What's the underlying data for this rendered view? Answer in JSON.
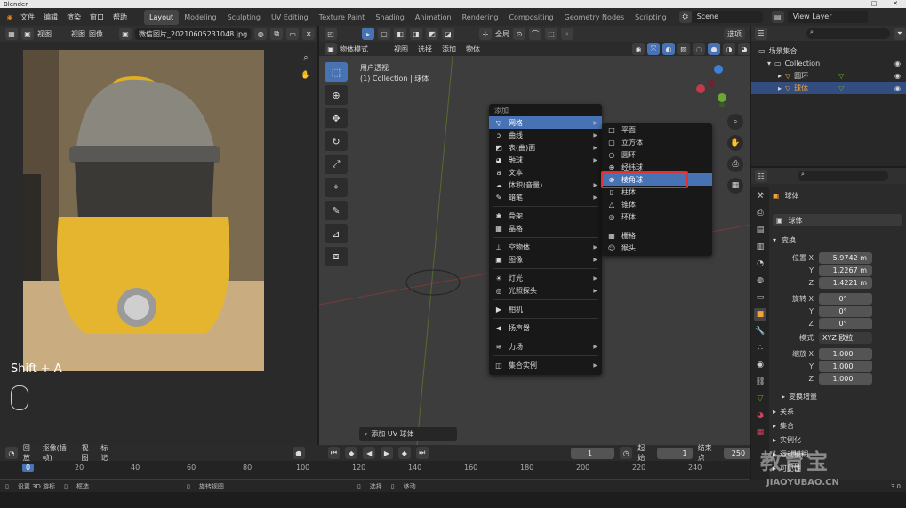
{
  "title": "Blender",
  "menu": [
    "文件",
    "编辑",
    "渲染",
    "窗口",
    "帮助"
  ],
  "workspaces": [
    "Layout",
    "Modeling",
    "Sculpting",
    "UV Editing",
    "Texture Paint",
    "Shading",
    "Animation",
    "Rendering",
    "Compositing",
    "Geometry Nodes",
    "Scripting"
  ],
  "scene": "Scene",
  "view_layer": "View Layer",
  "image_editor": {
    "menus": [
      "视图",
      "视图",
      "图像"
    ],
    "filename": "微信图片_20210605231048.jpg",
    "overlay_text": "Shift + A"
  },
  "viewport": {
    "mode": "物体模式",
    "menus": [
      "视图",
      "选择",
      "添加",
      "物体"
    ],
    "transform": "全局",
    "options": "选项",
    "view_name": "用户透视",
    "collection": "(1) Collection | 球体"
  },
  "add_menu": {
    "title": "添加",
    "items": [
      {
        "label": "网格",
        "glyph": "▽",
        "sub": true
      },
      {
        "label": "曲线",
        "glyph": "ↄ",
        "sub": true
      },
      {
        "label": "表(曲)面",
        "glyph": "◩",
        "sub": true
      },
      {
        "label": "融球",
        "glyph": "◕",
        "sub": true
      },
      {
        "label": "文本",
        "glyph": "a",
        "sub": false
      },
      {
        "label": "体积(音量)",
        "glyph": "☁",
        "sub": true
      },
      {
        "label": "蜡笔",
        "glyph": "✎",
        "sub": true
      },
      {
        "label": "骨架",
        "glyph": "✱",
        "sub": false
      },
      {
        "label": "晶格",
        "glyph": "▦",
        "sub": false
      },
      {
        "label": "空物体",
        "glyph": "⊥",
        "sub": true
      },
      {
        "label": "图像",
        "glyph": "▣",
        "sub": true
      },
      {
        "label": "灯光",
        "glyph": "☀",
        "sub": true
      },
      {
        "label": "光照探头",
        "glyph": "◎",
        "sub": true
      },
      {
        "label": "相机",
        "glyph": "▶",
        "sub": false
      },
      {
        "label": "扬声器",
        "glyph": "◀",
        "sub": false
      },
      {
        "label": "力场",
        "glyph": "≋",
        "sub": true
      },
      {
        "label": "集合实例",
        "glyph": "◫",
        "sub": true
      }
    ]
  },
  "mesh_submenu": [
    {
      "label": "平面",
      "glyph": "□"
    },
    {
      "label": "立方体",
      "glyph": "▢"
    },
    {
      "label": "圆环",
      "glyph": "○"
    },
    {
      "label": "经纬球",
      "glyph": "⊕"
    },
    {
      "label": "棱角球",
      "glyph": "⊗"
    },
    {
      "label": "柱体",
      "glyph": "▯"
    },
    {
      "label": "锥体",
      "glyph": "△"
    },
    {
      "label": "环体",
      "glyph": "◎"
    },
    {
      "label": "栅格",
      "glyph": "▦"
    },
    {
      "label": "猴头",
      "glyph": "☺"
    }
  ],
  "redo_panel": "添加 UV 球体",
  "outliner": {
    "root": "场景集合",
    "collection": "Collection",
    "items": [
      "圆环",
      "球体"
    ]
  },
  "properties": {
    "object_name": "球体",
    "mesh_name": "球体",
    "section_transform": "变换",
    "location_label": "位置 X",
    "location": [
      "5.9742 m",
      "1.2267 m",
      "1.4221 m"
    ],
    "rotation_label": "旋转 X",
    "rotation": [
      "0°",
      "0°",
      "0°"
    ],
    "mode_label": "模式",
    "mode_value": "XYZ 欧拉",
    "scale_label": "缩放 X",
    "scale": [
      "1.000",
      "1.000",
      "1.000"
    ],
    "axis_y": "Y",
    "axis_z": "Z",
    "sections": [
      "变换增量",
      "关系",
      "集合",
      "实例化",
      "运动模糊",
      "可见性"
    ]
  },
  "timeline": {
    "menus": [
      "回放",
      "抠像(插帧)",
      "视图",
      "标记"
    ],
    "current_frame": "1",
    "start_label": "起始",
    "start": "1",
    "end_label": "结束点",
    "end": "250",
    "ticks": [
      "0",
      "20",
      "40",
      "60",
      "80",
      "100",
      "120",
      "140",
      "160",
      "180",
      "200",
      "220",
      "240"
    ]
  },
  "statusbar": [
    "设置 3D 游标",
    "框选",
    "旋转视图",
    "选择",
    "移动"
  ],
  "version": "3.0",
  "watermark": {
    "text": "教育宝",
    "url": "JIAOYUBAO.CN"
  }
}
